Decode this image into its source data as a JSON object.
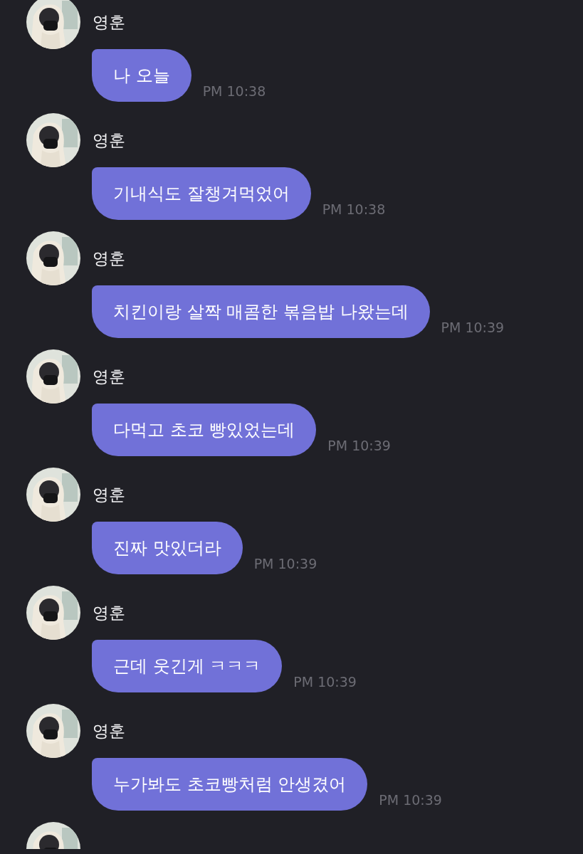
{
  "messages": [
    {
      "sender": "영훈",
      "text": "나 오늘",
      "time": "PM 10:38"
    },
    {
      "sender": "영훈",
      "text": "기내식도 잘챙겨먹었어",
      "time": "PM 10:38"
    },
    {
      "sender": "영훈",
      "text": "치킨이랑 살짝 매콤한 볶음밥 나왔는데",
      "time": "PM 10:39"
    },
    {
      "sender": "영훈",
      "text": "다먹고 초코 빵있었는데",
      "time": "PM 10:39"
    },
    {
      "sender": "영훈",
      "text": "진짜 맛있더라",
      "time": "PM 10:39"
    },
    {
      "sender": "영훈",
      "text": "근데 웃긴게 ㅋㅋㅋ",
      "time": "PM 10:39"
    },
    {
      "sender": "영훈",
      "text": "누가봐도 초코빵처럼 안생겼어",
      "time": "PM 10:39"
    }
  ]
}
